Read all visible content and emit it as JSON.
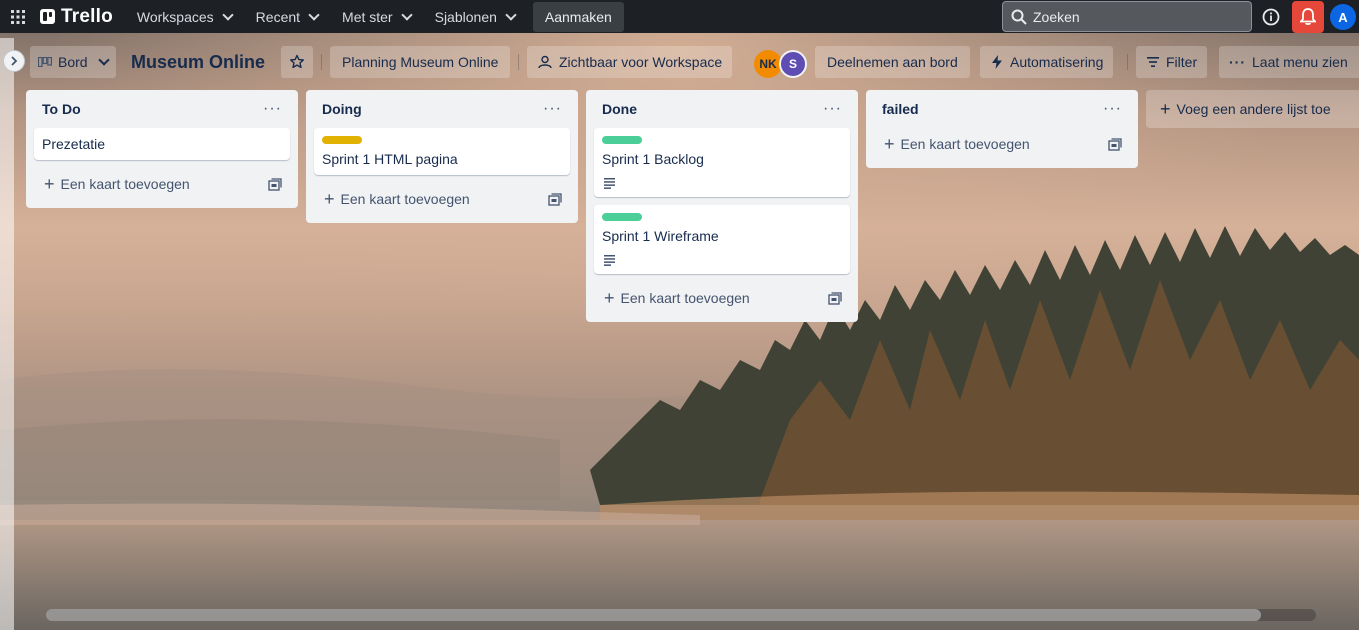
{
  "topnav": {
    "logo": "Trello",
    "menus": [
      "Workspaces",
      "Recent",
      "Met ster",
      "Sjablonen"
    ],
    "create_label": "Aanmaken",
    "search_placeholder": "Zoeken",
    "avatar_initial": "A"
  },
  "board": {
    "view_label": "Bord",
    "title": "Museum Online",
    "planning_label": "Planning Museum Online",
    "visibility_label": "Zichtbaar voor Workspace",
    "members": [
      "NK",
      "S"
    ],
    "join_label": "Deelnemen aan bord",
    "automation_label": "Automatisering",
    "filter_label": "Filter",
    "menu_label": "Laat menu zien"
  },
  "lists": [
    {
      "title": "To Do",
      "cards": [
        {
          "title": "Prezetatie",
          "label_color": "",
          "has_description": false
        }
      ],
      "add_card_label": "Een kaart toevoegen"
    },
    {
      "title": "Doing",
      "cards": [
        {
          "title": "Sprint 1 HTML pagina",
          "label_color": "#e2b203",
          "has_description": false
        }
      ],
      "add_card_label": "Een kaart toevoegen"
    },
    {
      "title": "Done",
      "cards": [
        {
          "title": "Sprint 1 Backlog",
          "label_color": "#4bce97",
          "has_description": true
        },
        {
          "title": "Sprint 1 Wireframe",
          "label_color": "#4bce97",
          "has_description": true
        }
      ],
      "add_card_label": "Een kaart toevoegen"
    },
    {
      "title": "failed",
      "cards": [],
      "add_card_label": "Een kaart toevoegen"
    }
  ],
  "add_list_label": "Voeg een andere lijst toe",
  "colors": {
    "nav_bg": "#1d2125",
    "bell_bg": "#e5483a",
    "avatar_bg": "#0c66e4",
    "member_nk": "#f38b00",
    "member_s": "#5e4db2",
    "label_yellow": "#e2b203",
    "label_green": "#4bce97"
  }
}
